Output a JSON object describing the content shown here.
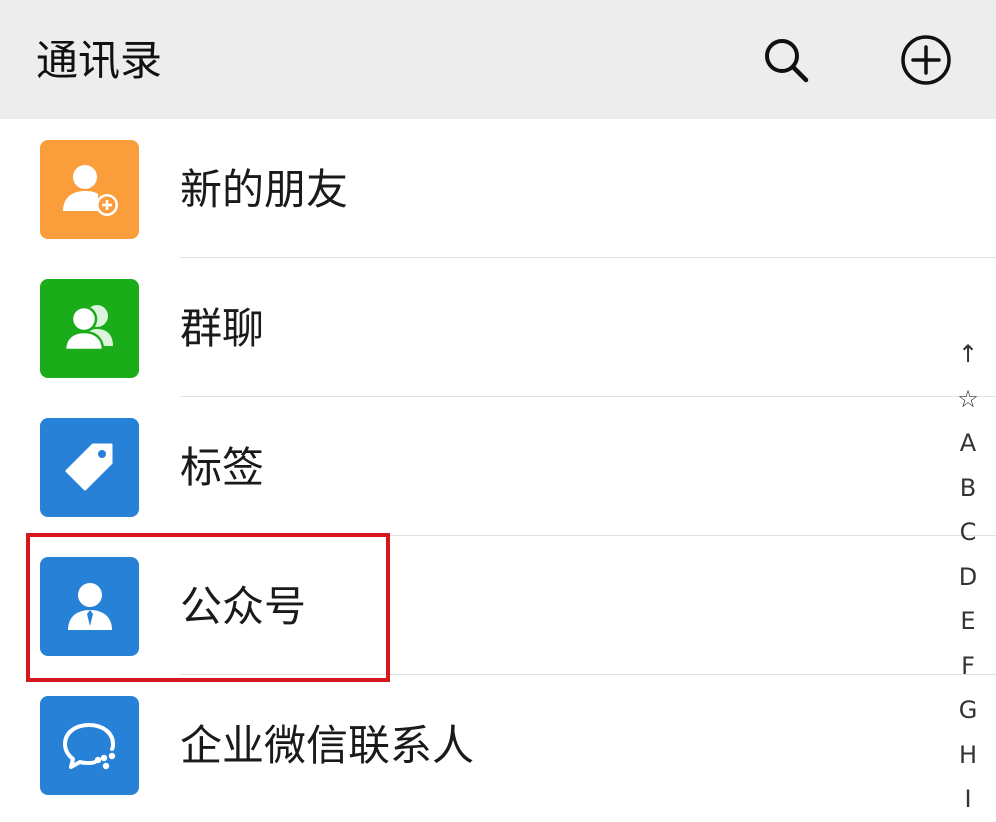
{
  "header": {
    "title": "通讯录",
    "search_icon": "search-icon",
    "add_icon": "plus-circle-icon"
  },
  "list": {
    "items": [
      {
        "label": "新的朋友",
        "icon": "add-friend-icon",
        "color": "#fa9d3b"
      },
      {
        "label": "群聊",
        "icon": "group-chat-icon",
        "color": "#1aad19"
      },
      {
        "label": "标签",
        "icon": "tag-icon",
        "color": "#2782d7"
      },
      {
        "label": "公众号",
        "icon": "official-account-icon",
        "color": "#2782d7"
      },
      {
        "label": "企业微信联系人",
        "icon": "wecom-contact-icon",
        "color": "#2782d7"
      }
    ]
  },
  "highlight": {
    "color": "#d6181e"
  },
  "index_bar": {
    "items": [
      "↑",
      "☆",
      "A",
      "B",
      "C",
      "D",
      "E",
      "F",
      "G",
      "H",
      "I"
    ]
  }
}
